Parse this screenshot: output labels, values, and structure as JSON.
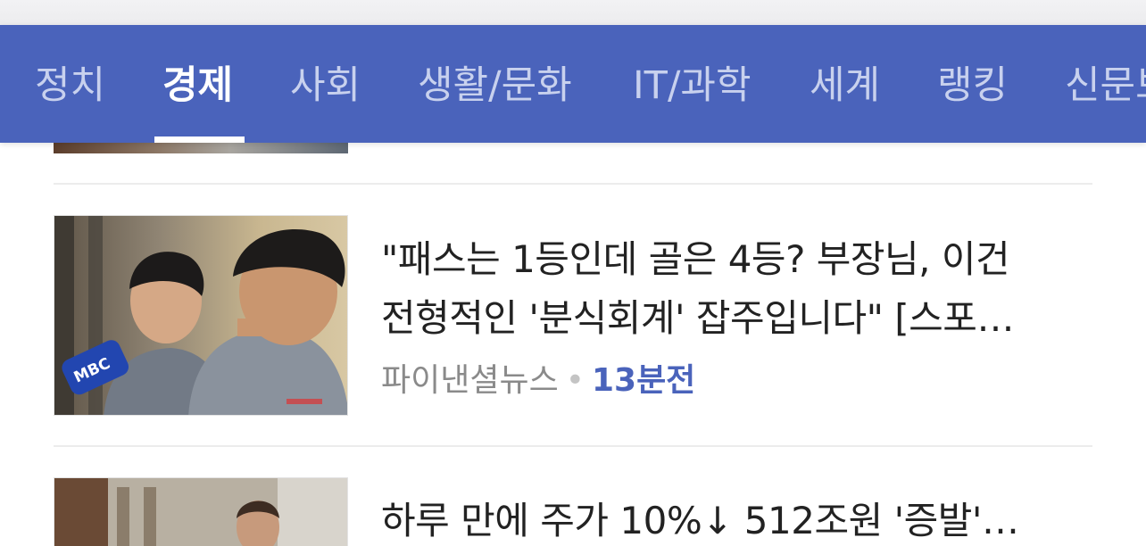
{
  "nav": {
    "items": [
      {
        "label": "정치"
      },
      {
        "label": "경제"
      },
      {
        "label": "사회"
      },
      {
        "label": "생활/문화"
      },
      {
        "label": "IT/과학"
      },
      {
        "label": "세계"
      },
      {
        "label": "랭킹"
      },
      {
        "label": "신문보"
      }
    ],
    "active": "경제"
  },
  "articles": [
    {
      "title_line1": "\"패스는 1등인데 골은 4등? 부장님, 이건",
      "title_line2": "전형적인 '분식회계' 잡주입니다\" [스포…",
      "source": "파이낸셜뉴스",
      "separator": "•",
      "time": "13분전",
      "thumbnail_mic_text": "MBC"
    },
    {
      "title_line1": "하루 만에 주가 10%↓ 512조원 '증발'…"
    }
  ],
  "colors": {
    "nav_bg": "#4a63bb",
    "accent_time": "#4a63bb"
  }
}
